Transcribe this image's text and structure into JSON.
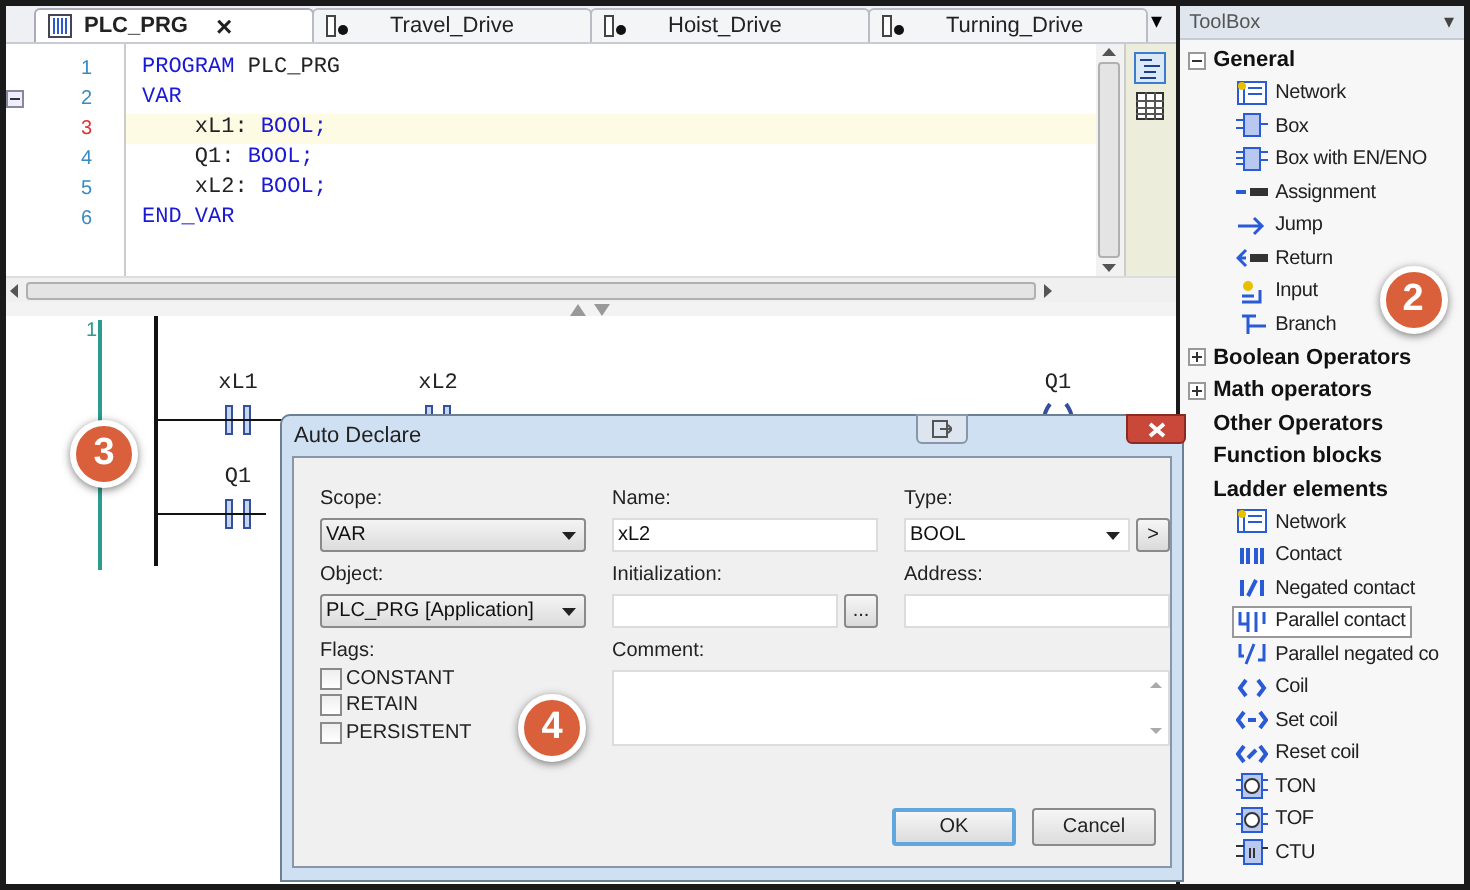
{
  "tabs": [
    {
      "label": "PLC_PRG",
      "kind": "program",
      "selected": true,
      "close": "×"
    },
    {
      "label": "Travel_Drive",
      "kind": "action",
      "selected": false
    },
    {
      "label": "Hoist_Drive",
      "kind": "action",
      "selected": false
    },
    {
      "label": "Turning_Drive",
      "kind": "action",
      "selected": false
    }
  ],
  "tab_menu": "▾",
  "declaration": {
    "lines": [
      {
        "number": "1",
        "current": false,
        "foldable": false,
        "segments": [
          {
            "text": "PROGRAM",
            "kind": "keyword"
          },
          {
            "text": " PLC_PRG",
            "kind": "ident"
          }
        ]
      },
      {
        "number": "2",
        "current": false,
        "foldable": true,
        "segments": [
          {
            "text": "VAR",
            "kind": "keyword"
          }
        ]
      },
      {
        "number": "3",
        "current": true,
        "foldable": false,
        "segments": [
          {
            "text": "    xL1: ",
            "kind": "ident"
          },
          {
            "text": "BOOL;",
            "kind": "keyword"
          }
        ]
      },
      {
        "number": "4",
        "current": false,
        "foldable": false,
        "segments": [
          {
            "text": "    Q1: ",
            "kind": "ident"
          },
          {
            "text": "BOOL;",
            "kind": "keyword"
          }
        ]
      },
      {
        "number": "5",
        "current": false,
        "foldable": false,
        "segments": [
          {
            "text": "    xL2: ",
            "kind": "ident"
          },
          {
            "text": "BOOL;",
            "kind": "keyword"
          }
        ]
      },
      {
        "number": "6",
        "current": false,
        "foldable": false,
        "segments": [
          {
            "text": "END_VAR",
            "kind": "keyword"
          }
        ]
      }
    ]
  },
  "ladder": {
    "network": "1",
    "badge": "3",
    "rungs": [
      {
        "elements": [
          {
            "kind": "contact",
            "label": "xL1"
          },
          {
            "kind": "contact",
            "label": "xL2"
          },
          {
            "kind": "coil",
            "label": "Q1"
          }
        ]
      },
      {
        "elements": [
          {
            "kind": "contact",
            "label": "Q1"
          }
        ]
      }
    ]
  },
  "dialog": {
    "title": "Auto Declare",
    "badge": "4",
    "scope": {
      "label": "Scope:",
      "value": "VAR"
    },
    "name": {
      "label": "Name:",
      "value": "xL2"
    },
    "type": {
      "label": "Type:",
      "value": "BOOL",
      "button": ">"
    },
    "object": {
      "label": "Object:",
      "value": "PLC_PRG [Application]"
    },
    "initialization": {
      "label": "Initialization:",
      "button": "..."
    },
    "address": {
      "label": "Address:"
    },
    "flags": {
      "label": "Flags:",
      "options": [
        {
          "label": "CONSTANT",
          "checked": false
        },
        {
          "label": "RETAIN",
          "checked": false
        },
        {
          "label": "PERSISTENT",
          "checked": false
        }
      ]
    },
    "comment": {
      "label": "Comment:"
    },
    "buttons": [
      {
        "label": "OK",
        "default": true
      },
      {
        "label": "Cancel",
        "default": false
      }
    ]
  },
  "toolbox": {
    "title": "ToolBox",
    "menu": "▾",
    "badge": "2",
    "groups": [
      {
        "label": "General",
        "expanded": true,
        "items": [
          {
            "label": "Network",
            "kind": "network",
            "selected": false
          },
          {
            "label": "Box",
            "kind": "box",
            "selected": false
          },
          {
            "label": "Box with EN/ENO",
            "kind": "box-en",
            "selected": false
          },
          {
            "label": "Assignment",
            "kind": "assignment",
            "selected": false
          },
          {
            "label": "Jump",
            "kind": "jump",
            "selected": false
          },
          {
            "label": "Return",
            "kind": "return",
            "selected": false
          },
          {
            "label": "Input",
            "kind": "input",
            "selected": false
          },
          {
            "label": "Branch",
            "kind": "branch",
            "selected": false
          }
        ]
      },
      {
        "label": "Boolean Operators",
        "expanded": false
      },
      {
        "label": "Math operators",
        "expanded": false
      },
      {
        "label": "Other Operators"
      },
      {
        "label": "Function blocks"
      },
      {
        "label": "Ladder elements",
        "items": [
          {
            "label": "Network",
            "kind": "network",
            "selected": false
          },
          {
            "label": "Contact",
            "kind": "contact",
            "selected": false
          },
          {
            "label": "Negated contact",
            "kind": "negated-contact",
            "selected": false
          },
          {
            "label": "Parallel contact",
            "kind": "parallel-contact",
            "selected": true
          },
          {
            "label": "Parallel negated co",
            "kind": "parallel-negated-contact",
            "selected": false
          },
          {
            "label": "Coil",
            "kind": "coil",
            "selected": false
          },
          {
            "label": "Set coil",
            "kind": "set-coil",
            "selected": false
          },
          {
            "label": "Reset coil",
            "kind": "reset-coil",
            "selected": false
          },
          {
            "label": "TON",
            "kind": "timer",
            "selected": false
          },
          {
            "label": "TOF",
            "kind": "timer",
            "selected": false
          },
          {
            "label": "CTU",
            "kind": "counter",
            "selected": false
          }
        ]
      }
    ]
  }
}
